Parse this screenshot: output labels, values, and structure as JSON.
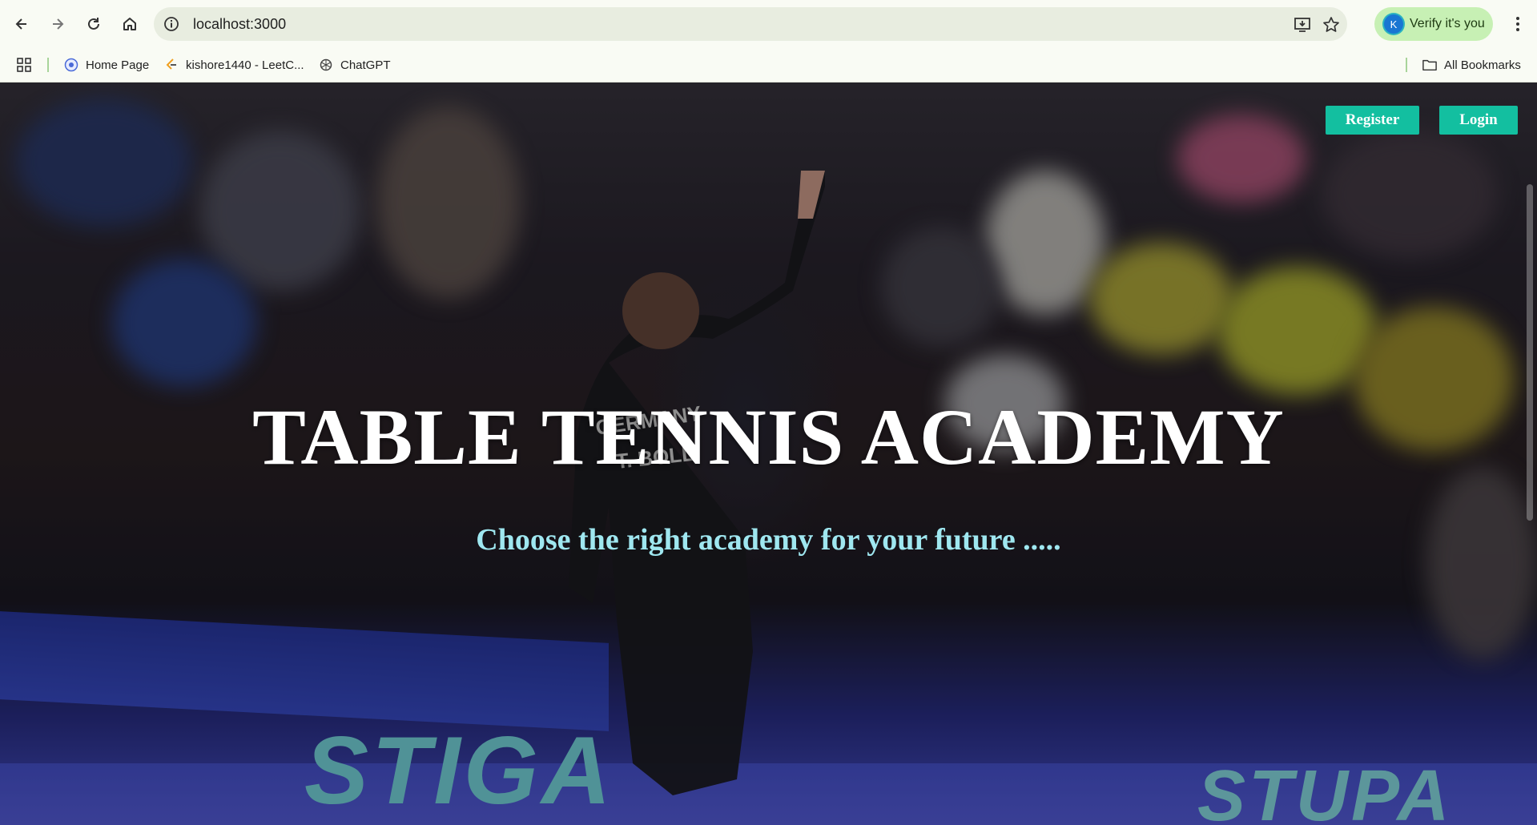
{
  "browser": {
    "url": "localhost:3000",
    "verify_label": "Verify it's you",
    "avatar_letter": "K",
    "bookmarks": [
      {
        "label": "Home Page"
      },
      {
        "label": "kishore1440 - LeetC..."
      },
      {
        "label": "ChatGPT"
      }
    ],
    "all_bookmarks_label": "All Bookmarks"
  },
  "page": {
    "register_label": "Register",
    "login_label": "Login",
    "title": "TABLE TENNIS ACADEMY",
    "subtitle": "Choose the right academy for your future .....",
    "photo": {
      "jersey_line1": "GERMANY",
      "jersey_line2": "T. BOLL",
      "banner_left": "STIGA",
      "banner_right": "STUPA"
    }
  },
  "colors": {
    "accent_button": "#13bfa0",
    "subtitle": "#9fe7f0",
    "verify_chip": "#c7f0b4"
  }
}
